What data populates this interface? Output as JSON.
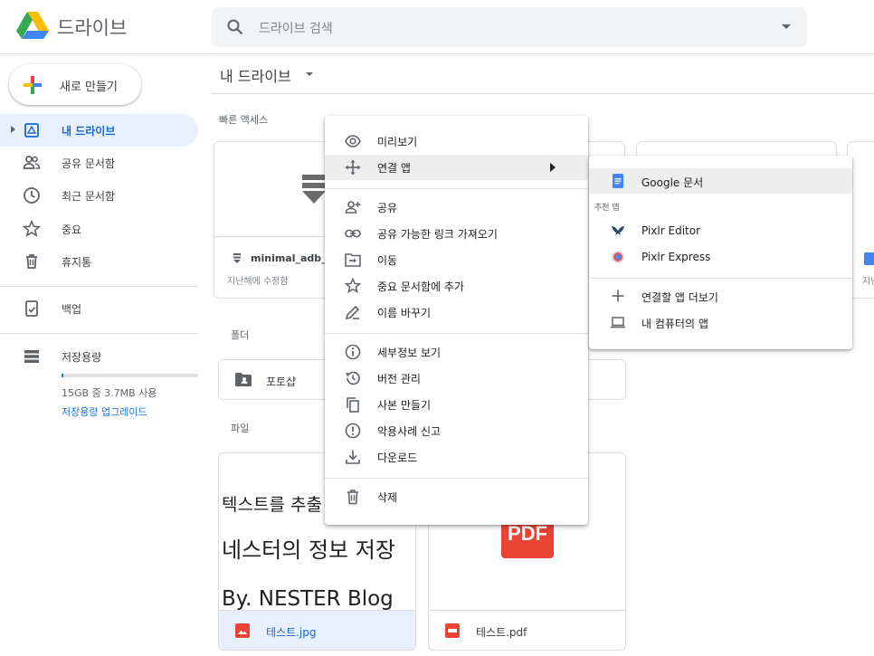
{
  "header": {
    "brand": "드라이브",
    "search_placeholder": "드라이브 검색"
  },
  "sidebar": {
    "new_button": "새로 만들기",
    "items": [
      {
        "label": "내 드라이브",
        "icon": "my-drive-icon",
        "active": true
      },
      {
        "label": "공유 문서함",
        "icon": "shared-people-icon"
      },
      {
        "label": "최근 문서함",
        "icon": "clock-icon"
      },
      {
        "label": "중요",
        "icon": "star-icon"
      },
      {
        "label": "휴지통",
        "icon": "trash-icon"
      }
    ],
    "backup": "백업",
    "storage": {
      "label": "저장용량",
      "used": "15GB 중 3.7MB 사용",
      "upgrade": "저장용량 업그레이드",
      "fraction": 0.0002
    }
  },
  "main": {
    "breadcrumb": "내 드라이브",
    "quick_access_label": "빠른 액세스",
    "quick_access": [
      {
        "name": "minimal_adb_fa",
        "sub": "지난해에 수정함"
      },
      {
        "name": "",
        "sub": "지난"
      }
    ],
    "folders_label": "폴더",
    "folders": [
      {
        "name": "포토샵"
      }
    ],
    "files_label": "파일",
    "files": [
      {
        "name": "테스트.jpg",
        "preview_lines": [
          "텍스트를 추출",
          "네스터의 정보 저장",
          "By. NESTER Blog"
        ]
      },
      {
        "name": "테스트.pdf",
        "thumb": "PDF"
      }
    ]
  },
  "context_menu": {
    "items": [
      {
        "label": "미리보기",
        "icon": "eye-icon"
      },
      {
        "label": "연결 앱",
        "icon": "move-arrows-icon",
        "submenu": true
      },
      {
        "label": "공유",
        "icon": "add-person-icon"
      },
      {
        "label": "공유 가능한 링크 가져오기",
        "icon": "link-icon"
      },
      {
        "label": "이동",
        "icon": "move-to-folder-icon"
      },
      {
        "label": "중요 문서함에 추가",
        "icon": "star-icon"
      },
      {
        "label": "이름 바꾸기",
        "icon": "pencil-icon"
      },
      {
        "label": "세부정보 보기",
        "icon": "info-icon"
      },
      {
        "label": "버전 관리",
        "icon": "history-icon"
      },
      {
        "label": "사본 만들기",
        "icon": "copy-icon"
      },
      {
        "label": "악용사례 신고",
        "icon": "alert-icon"
      },
      {
        "label": "다운로드",
        "icon": "download-icon"
      },
      {
        "label": "삭제",
        "icon": "trash-icon"
      }
    ]
  },
  "submenu": {
    "items": [
      {
        "label": "Google 문서",
        "icon": "google-docs-icon"
      },
      {
        "label": "Pixlr Editor",
        "icon": "pixlr-editor-icon"
      },
      {
        "label": "Pixlr Express",
        "icon": "pixlr-express-icon"
      },
      {
        "label": "연결할 앱 더보기",
        "icon": "plus-icon"
      },
      {
        "label": "내 컴퓨터의 앱",
        "icon": "laptop-icon"
      }
    ],
    "suggested_header": "추천 앱"
  },
  "colors": {
    "accent": "#1a73e8",
    "active_bg": "#e8f0fe",
    "pdf_red": "#ea4335"
  }
}
